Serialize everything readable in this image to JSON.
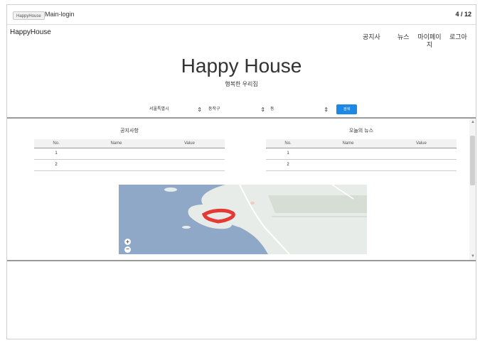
{
  "topbar": {
    "tag": "HappyHouse",
    "page_name": "Main-login",
    "page_counter": "4 / 12"
  },
  "header": {
    "brand": "HappyHouse",
    "nav": {
      "notice": "공지사",
      "news": "뉴스",
      "mypage": "마이페이지",
      "logout": "로그아"
    }
  },
  "hero": {
    "title": "Happy House",
    "subtitle": "행복한 우리집"
  },
  "filters": {
    "city": "서울특별시",
    "district": "동작구",
    "dong": "동",
    "search_label": "검색"
  },
  "notices": {
    "title": "공지사항",
    "columns": [
      "No.",
      "Name",
      "Value"
    ],
    "rows": [
      {
        "no": "1",
        "name": "",
        "value": ""
      },
      {
        "no": "2",
        "name": "",
        "value": ""
      }
    ]
  },
  "news": {
    "title": "오늘의 뉴스",
    "columns": [
      "No.",
      "Name",
      "Value"
    ],
    "rows": [
      {
        "no": "1",
        "name": "",
        "value": ""
      },
      {
        "no": "2",
        "name": "",
        "value": ""
      }
    ]
  },
  "map": {
    "zoom_in": "+",
    "zoom_out": "−",
    "colors": {
      "water": "#8fa8c8",
      "land": "#e8ece8",
      "highlight": "#e53935"
    }
  },
  "icons": {
    "select_arrow": "updown-arrow-icon",
    "scroll_up": "scroll-up-arrow-icon",
    "scroll_down": "scroll-down-arrow-icon"
  },
  "colors": {
    "accent": "#1e88e5"
  }
}
